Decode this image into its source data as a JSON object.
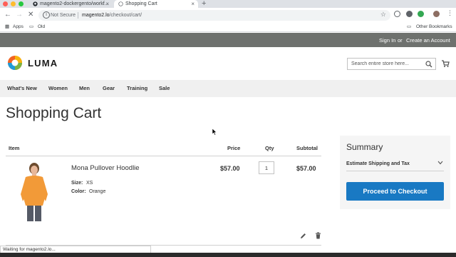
{
  "browser": {
    "tabs": [
      {
        "title": "magento2-dockergento/workf...",
        "active": false
      },
      {
        "title": "Shopping Cart",
        "active": true
      }
    ],
    "new_tab_label": "+",
    "nav": {
      "back": "←",
      "forward": "→",
      "reload": "✕"
    },
    "address": {
      "security_label": "Not Secure",
      "host": "magento2.lo",
      "path": "/checkout/cart/"
    },
    "bookmarks": {
      "apps": "Apps",
      "old": "Old",
      "other": "Other Bookmarks"
    },
    "status_text": "Waiting for magento2.lo..."
  },
  "site": {
    "panel": {
      "sign_in": "Sign In",
      "or": "or",
      "create_account": "Create an Account"
    },
    "logo_text": "LUMA",
    "search_placeholder": "Search entire store here...",
    "nav": [
      "What's New",
      "Women",
      "Men",
      "Gear",
      "Training",
      "Sale"
    ]
  },
  "cart": {
    "page_title": "Shopping Cart",
    "columns": {
      "item": "Item",
      "price": "Price",
      "qty": "Qty",
      "subtotal": "Subtotal"
    },
    "items": [
      {
        "name": "Mona Pullover Hoodlie",
        "options": [
          {
            "label": "Size:",
            "value": "XS"
          },
          {
            "label": "Color:",
            "value": "Orange"
          }
        ],
        "price": "$57.00",
        "qty": "1",
        "subtotal": "$57.00"
      }
    ]
  },
  "summary": {
    "title": "Summary",
    "estimate_label": "Estimate Shipping and Tax",
    "checkout_label": "Proceed to Checkout"
  },
  "colors": {
    "panel": "#6e716e",
    "nav_bg": "#f0f0f0",
    "primary_button": "#1979c3",
    "summary_bg": "#f5f5f5"
  }
}
